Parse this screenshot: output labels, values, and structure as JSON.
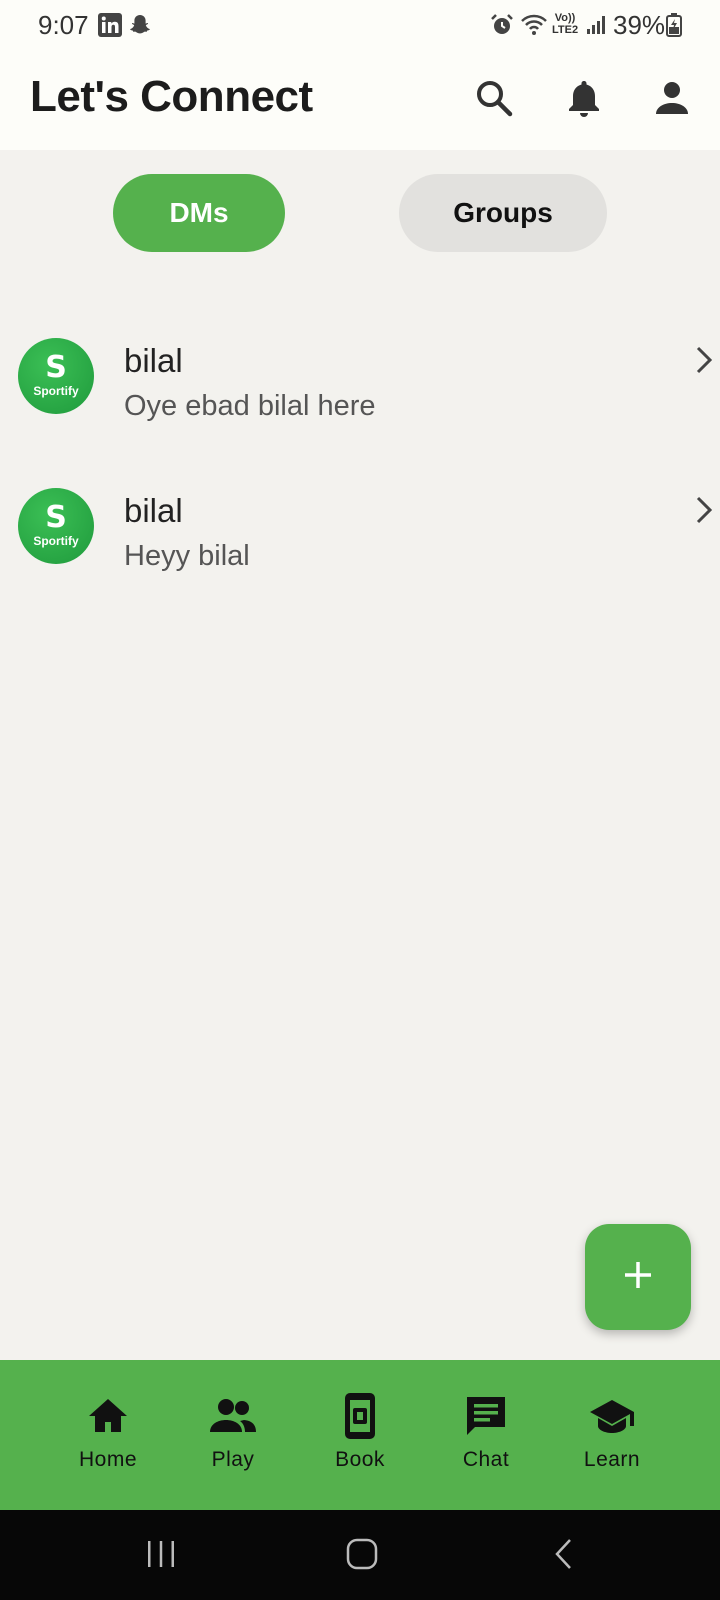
{
  "status_bar": {
    "time": "9:07",
    "battery": "39%",
    "icons": [
      "linkedin-icon",
      "snapchat-icon",
      "alarm-icon",
      "wifi-icon",
      "volte-icon",
      "signal-icon",
      "battery-icon"
    ],
    "volte_line1": "Vo))",
    "volte_line2": "LTE2"
  },
  "app_bar": {
    "title": "Let's Connect",
    "icons": [
      "search-icon",
      "bell-icon",
      "profile-icon"
    ]
  },
  "tabs": [
    {
      "label": "DMs",
      "active": true
    },
    {
      "label": "Groups",
      "active": false
    }
  ],
  "chats": [
    {
      "name": "bilal",
      "message": "Oye ebad bilal here",
      "avatar_text": "Sportify",
      "avatar_letter": "S"
    },
    {
      "name": "bilal",
      "message": "Heyy bilal",
      "avatar_text": "Sportify",
      "avatar_letter": "S"
    }
  ],
  "fab": {
    "icon": "plus-icon"
  },
  "bottom_nav": {
    "items": [
      {
        "label": "Home",
        "icon": "home-icon"
      },
      {
        "label": "Play",
        "icon": "people-icon"
      },
      {
        "label": "Book",
        "icon": "booking-icon"
      },
      {
        "label": "Chat",
        "icon": "chat-icon"
      },
      {
        "label": "Learn",
        "icon": "graduation-cap-icon"
      }
    ]
  },
  "system_nav": {
    "icons": [
      "recent-apps-icon",
      "home-button-icon",
      "back-icon"
    ]
  },
  "colors": {
    "accent": "#55b14d",
    "background": "#f3f2ee",
    "appbar": "#fdfdf9",
    "tab_inactive": "#e2e1de",
    "system_nav": "#070707"
  }
}
